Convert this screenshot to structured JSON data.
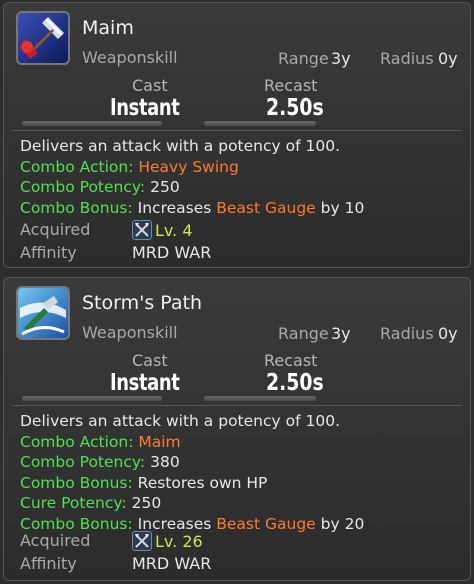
{
  "actions": [
    {
      "name": "Maim",
      "type": "Weaponskill",
      "range_label": "Range",
      "range_value": "3y",
      "radius_label": "Radius",
      "radius_value": "0y",
      "cast_label": "Cast",
      "cast_value": "Instant",
      "recast_label": "Recast",
      "recast_value": "2.50s",
      "description": "Delivers an attack with a potency of 100.",
      "combo_action_label": "Combo Action:",
      "combo_action_value": "Heavy Swing",
      "combo_potency_label": "Combo Potency:",
      "combo_potency_value": "250",
      "combo_bonus_label": "Combo Bonus:",
      "combo_bonus_pre": "Increases",
      "combo_bonus_highlight": "Beast Gauge",
      "combo_bonus_post": "by 10",
      "acquired_label": "Acquired",
      "acquired_value": "Lv. 4",
      "affinity_label": "Affinity",
      "affinity_value": "MRD WAR"
    },
    {
      "name": "Storm's Path",
      "type": "Weaponskill",
      "range_label": "Range",
      "range_value": "3y",
      "radius_label": "Radius",
      "radius_value": "0y",
      "cast_label": "Cast",
      "cast_value": "Instant",
      "recast_label": "Recast",
      "recast_value": "2.50s",
      "description": "Delivers an attack with a potency of 100.",
      "combo_action_label": "Combo Action:",
      "combo_action_value": "Maim",
      "combo_potency_label": "Combo Potency:",
      "combo_potency_value": "380",
      "combo_bonus1_label": "Combo Bonus:",
      "combo_bonus1_value": "Restores own HP",
      "cure_potency_label": "Cure Potency:",
      "cure_potency_value": "250",
      "combo_bonus2_label": "Combo Bonus:",
      "combo_bonus2_pre": "Increases",
      "combo_bonus2_highlight": "Beast Gauge",
      "combo_bonus2_post": "by 20",
      "acquired_label": "Acquired",
      "acquired_value": "Lv. 26",
      "affinity_label": "Affinity",
      "affinity_value": "MRD WAR"
    }
  ],
  "colors": {
    "combo_label": "#4fe04f",
    "highlight": "#ff7a2a",
    "level": "#c9e84a"
  },
  "icons": [
    "maim-action-icon",
    "storms-path-action-icon",
    "job-crossed-axes-icon"
  ]
}
